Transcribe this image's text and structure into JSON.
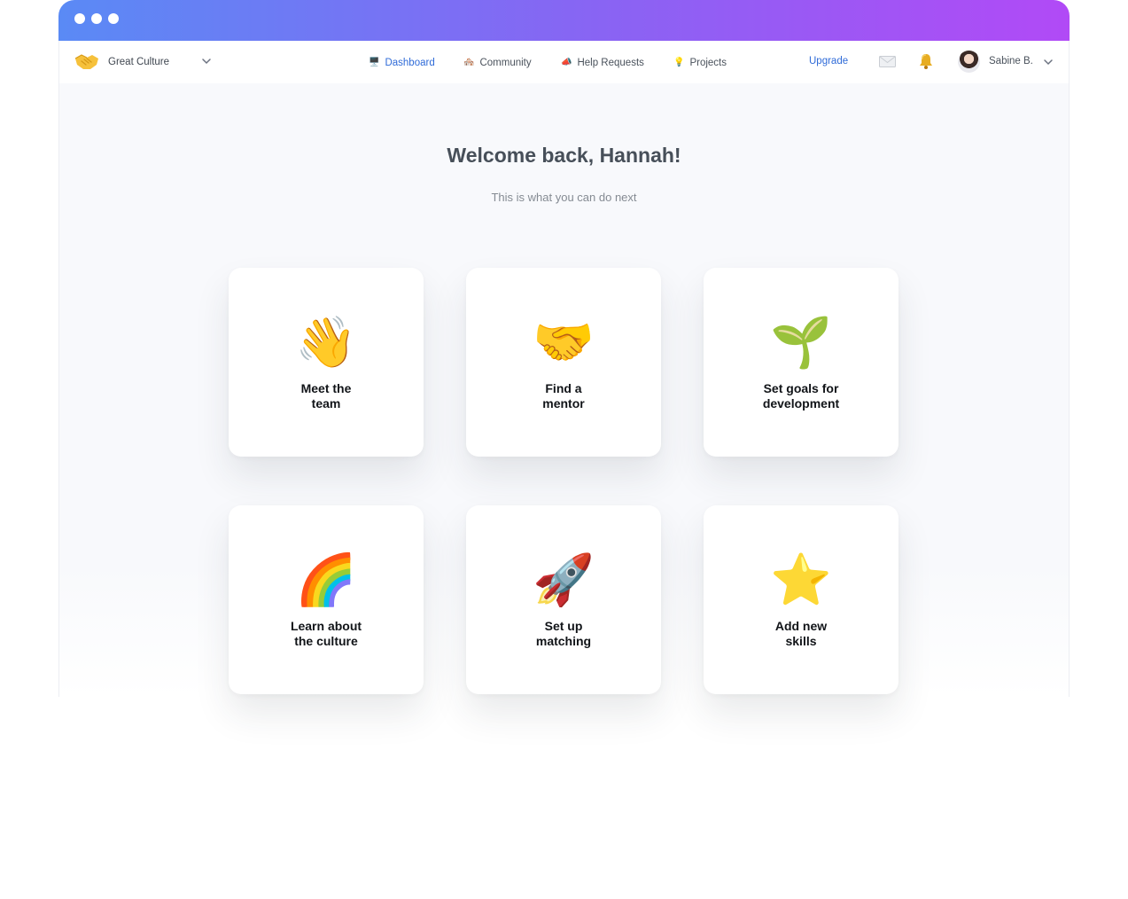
{
  "window": {
    "controls": [
      "window-dot",
      "window-dot",
      "window-dot"
    ]
  },
  "brand": {
    "name": "Great Culture",
    "logo_icon": "handshake-icon"
  },
  "nav": {
    "items": [
      {
        "label": "Dashboard",
        "icon": "🖥️",
        "icon_name": "desktop-computer-icon",
        "active": true
      },
      {
        "label": "Community",
        "icon": "🏘️",
        "icon_name": "houses-icon",
        "active": false
      },
      {
        "label": "Help Requests",
        "icon": "📣",
        "icon_name": "megaphone-icon",
        "active": false
      },
      {
        "label": "Projects",
        "icon": "💡",
        "icon_name": "light-bulb-icon",
        "active": false
      }
    ],
    "upgrade_label": "Upgrade"
  },
  "user": {
    "name": "Sabine B.",
    "avatar": "avatar"
  },
  "main": {
    "title": "Welcome back, Hannah!",
    "subtitle": "This is what you can do next"
  },
  "cards": [
    {
      "label": "Meet the\nteam",
      "emoji": "👋",
      "icon_name": "waving-hand-icon"
    },
    {
      "label": "Find a\nmentor",
      "emoji": "🤝",
      "icon_name": "handshake-icon"
    },
    {
      "label": "Set goals for\ndevelopment",
      "emoji": "🌱",
      "icon_name": "seedling-icon"
    },
    {
      "label": "Learn about\nthe culture",
      "emoji": "🌈",
      "icon_name": "rainbow-icon"
    },
    {
      "label": "Set up\nmatching",
      "emoji": "🚀",
      "icon_name": "rocket-icon"
    },
    {
      "label": "Add new\nskills",
      "emoji": "⭐",
      "icon_name": "star-icon"
    }
  ],
  "colors": {
    "accent": "#2f6bd8",
    "gradient_start": "#5a8af5",
    "gradient_end": "#b14af6",
    "title_text": "#474f59"
  }
}
